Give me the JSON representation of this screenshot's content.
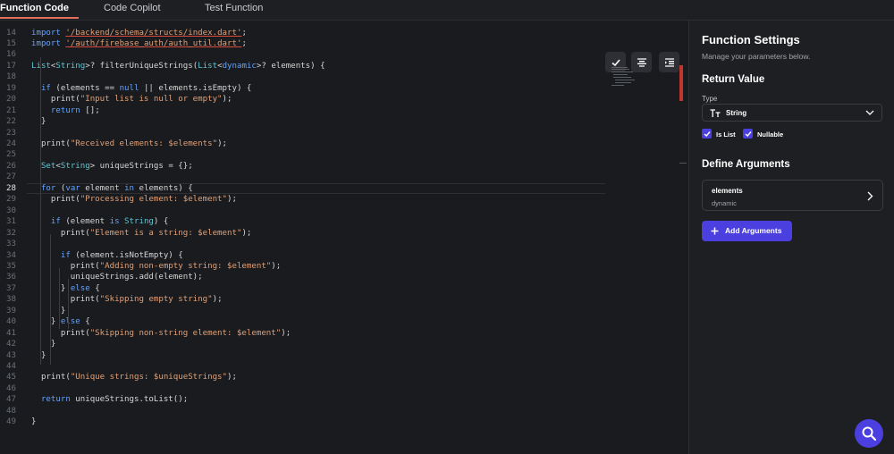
{
  "tabs": [
    {
      "label": "Function Code",
      "active": true
    },
    {
      "label": "Code Copilot",
      "active": false
    },
    {
      "label": "Test Function",
      "active": false
    }
  ],
  "editor": {
    "current_line": 28,
    "toolbar": [
      {
        "name": "check-button",
        "icon": "check-icon"
      },
      {
        "name": "format-button",
        "icon": "align-center-icon"
      },
      {
        "name": "indent-button",
        "icon": "indent-icon"
      }
    ],
    "lines": [
      {
        "n": "14",
        "html": "<span class=\"kw\">import</span> <span class=\"strsq\">'/backend/schema/structs/index.dart'</span>;"
      },
      {
        "n": "15",
        "html": "<span class=\"kw\">import</span> <span class=\"strsq\">'/auth/firebase_auth/auth_util.dart'</span>;"
      },
      {
        "n": "16",
        "html": ""
      },
      {
        "n": "17",
        "html": "<span class=\"ty\">List</span>&lt;<span class=\"ty\">String</span>&gt;? filterUniqueStrings(<span class=\"ty\">List</span>&lt;<span class=\"kw\">dynamic</span>&gt;? elements) {"
      },
      {
        "n": "18",
        "html": ""
      },
      {
        "n": "19",
        "html": "  <span class=\"kw\">if</span> (elements == <span class=\"kw\">null</span> || elements.isEmpty) {"
      },
      {
        "n": "20",
        "html": "    print(<span class=\"str\">\"Input list is null or empty\"</span>);"
      },
      {
        "n": "21",
        "html": "    <span class=\"kw\">return</span> [];"
      },
      {
        "n": "22",
        "html": "  }"
      },
      {
        "n": "23",
        "html": ""
      },
      {
        "n": "24",
        "html": "  print(<span class=\"str\">\"Received elements: $elements\"</span>);"
      },
      {
        "n": "25",
        "html": ""
      },
      {
        "n": "26",
        "html": "  <span class=\"ty\">Set</span>&lt;<span class=\"ty\">String</span>&gt; uniqueStrings = {};"
      },
      {
        "n": "27",
        "html": ""
      },
      {
        "n": "28",
        "html": "  <span class=\"kw\">for</span> (<span class=\"kw\">var</span> element <span class=\"kw\">in</span> elements) {"
      },
      {
        "n": "29",
        "html": "    print(<span class=\"str\">\"Processing element: $element\"</span>);"
      },
      {
        "n": "30",
        "html": ""
      },
      {
        "n": "31",
        "html": "    <span class=\"kw\">if</span> (element <span class=\"kw\">is</span> <span class=\"ty\">String</span>) {"
      },
      {
        "n": "32",
        "html": "      print(<span class=\"str\">\"Element is a string: $element\"</span>);"
      },
      {
        "n": "33",
        "html": ""
      },
      {
        "n": "34",
        "html": "      <span class=\"kw\">if</span> (element.isNotEmpty) {"
      },
      {
        "n": "35",
        "html": "        print(<span class=\"str\">\"Adding non-empty string: $element\"</span>);"
      },
      {
        "n": "36",
        "html": "        uniqueStrings.add(element);"
      },
      {
        "n": "37",
        "html": "      } <span class=\"kw\">else</span> {"
      },
      {
        "n": "38",
        "html": "        print(<span class=\"str\">\"Skipping empty string\"</span>);"
      },
      {
        "n": "39",
        "html": "      }"
      },
      {
        "n": "40",
        "html": "    } <span class=\"kw\">else</span> {"
      },
      {
        "n": "41",
        "html": "      print(<span class=\"str\">\"Skipping non-string element: $element\"</span>);"
      },
      {
        "n": "42",
        "html": "    }"
      },
      {
        "n": "43",
        "html": "  }"
      },
      {
        "n": "44",
        "html": ""
      },
      {
        "n": "45",
        "html": "  print(<span class=\"str\">\"Unique strings: $uniqueStrings\"</span>);"
      },
      {
        "n": "46",
        "html": ""
      },
      {
        "n": "47",
        "html": "  <span class=\"kw\">return</span> uniqueStrings.toList();"
      },
      {
        "n": "48",
        "html": ""
      },
      {
        "n": "49",
        "html": "}"
      }
    ]
  },
  "panel": {
    "title": "Function Settings",
    "subtitle": "Manage your parameters below.",
    "return_value": {
      "heading": "Return Value",
      "type_label": "Type",
      "type_value": "String",
      "type_icon": "text-type-icon",
      "is_list_label": "Is List",
      "is_list": true,
      "nullable_label": "Nullable",
      "nullable": true
    },
    "arguments": {
      "heading": "Define Arguments",
      "items": [
        {
          "name": "elements",
          "type": "dynamic"
        }
      ],
      "add_label": "Add Arguments"
    }
  },
  "colors": {
    "accent": "#4b3fe0",
    "tab_underline": "#e36f5a",
    "keyword": "#63a2ff",
    "type": "#5fc7d6",
    "string": "#e0a178",
    "scroll_marker": "#c0362c"
  }
}
